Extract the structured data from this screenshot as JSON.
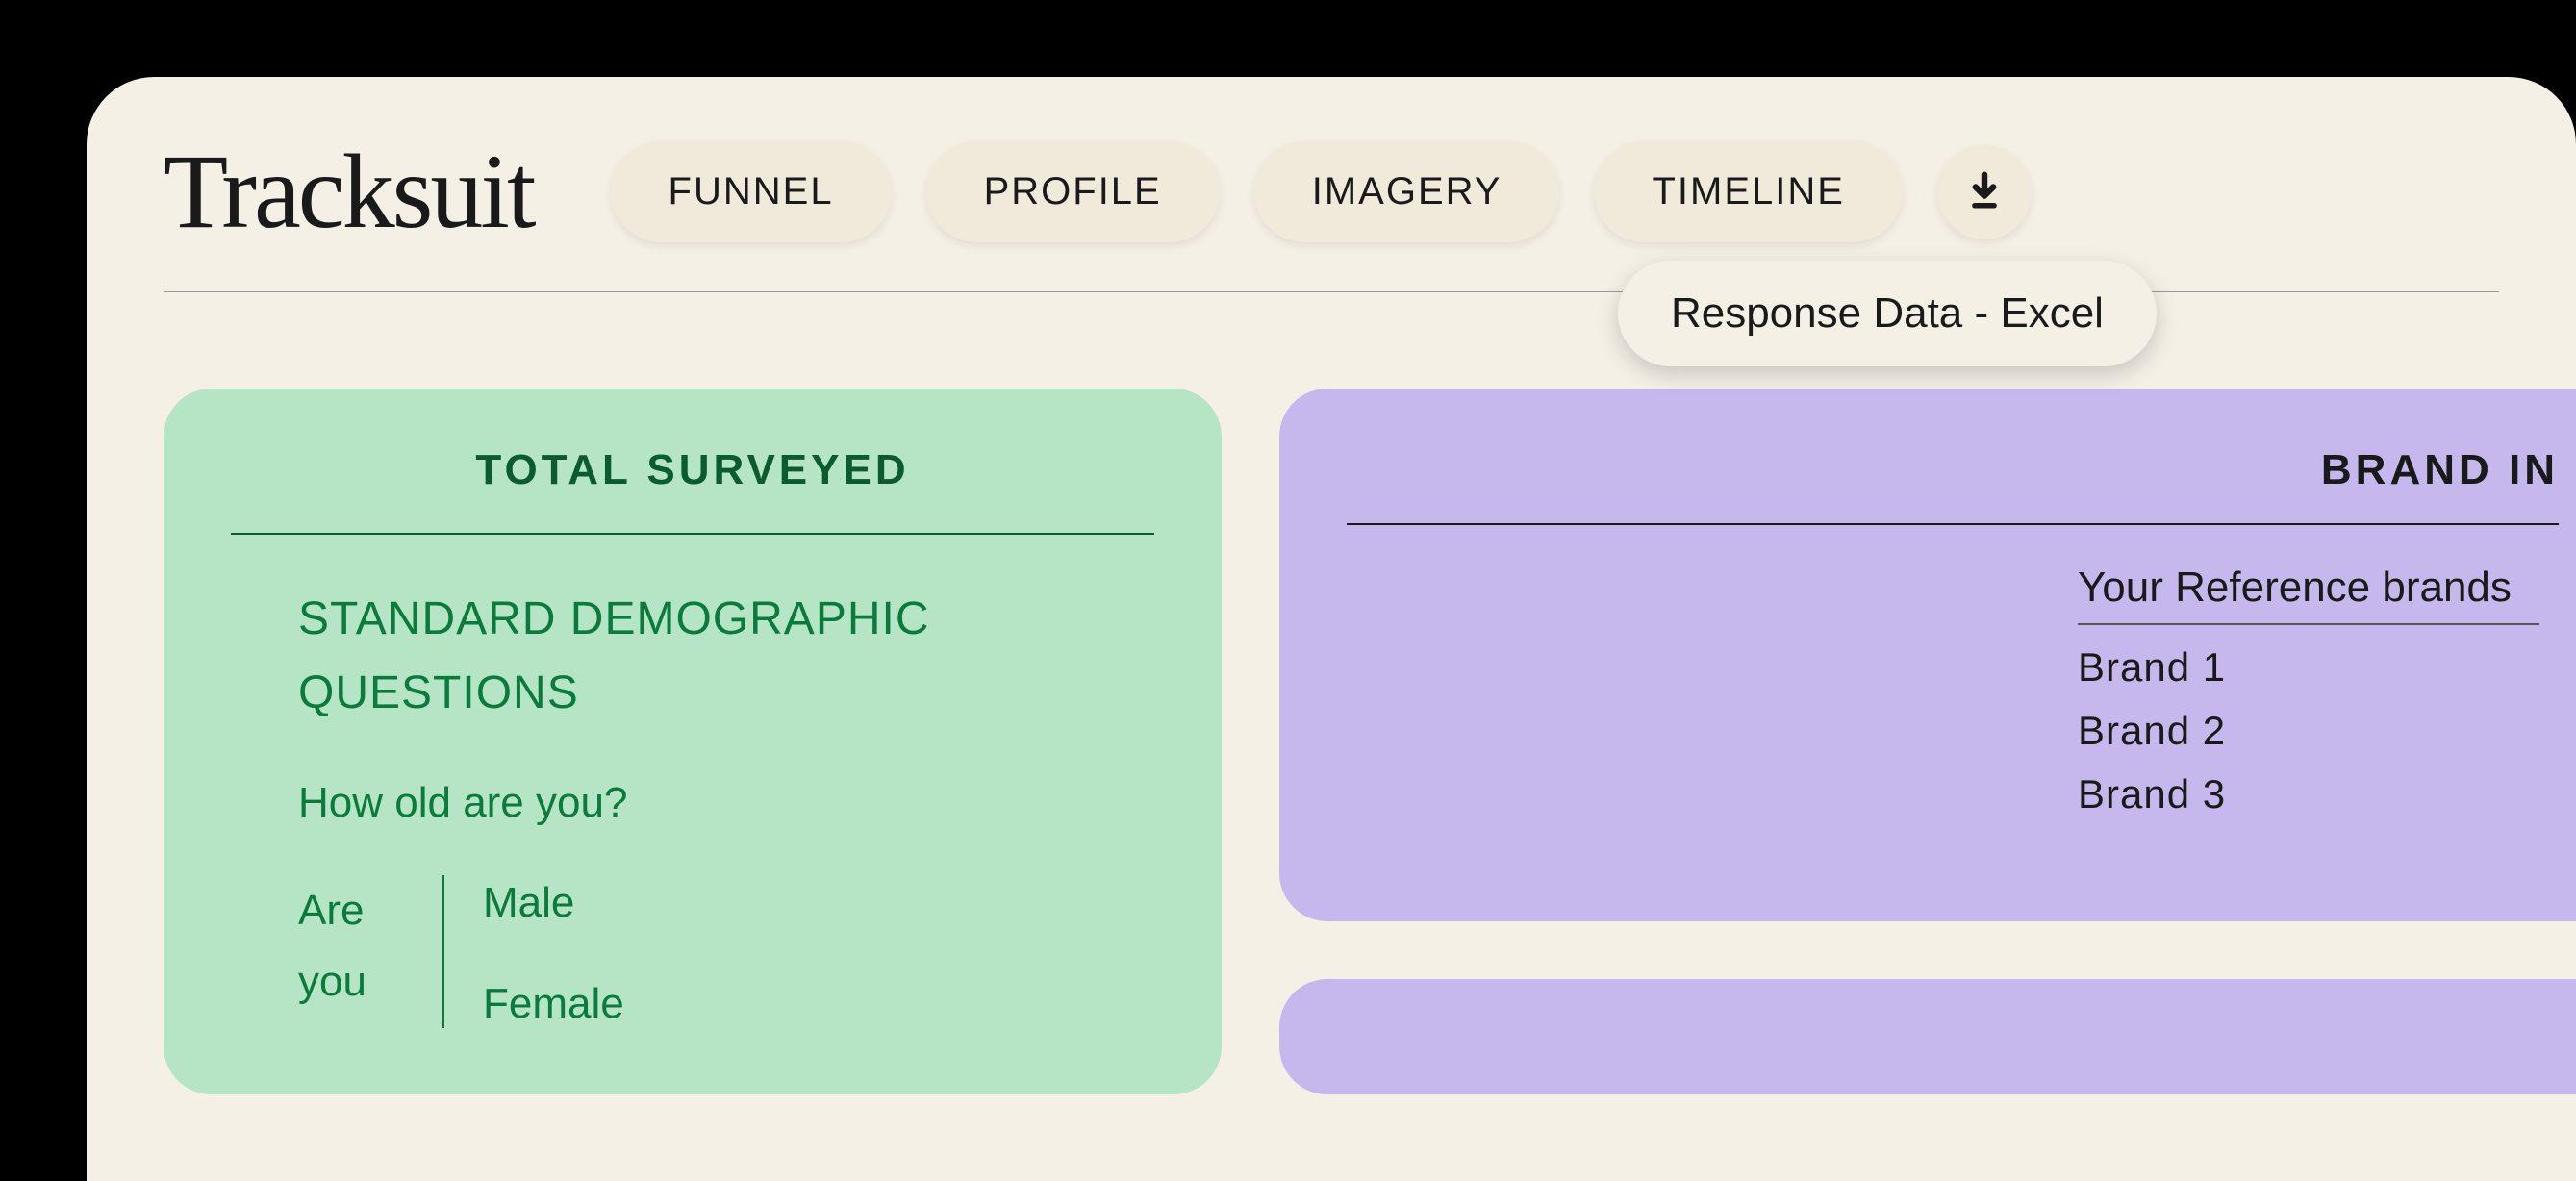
{
  "header": {
    "logo": "Tracksuit",
    "nav": {
      "items": [
        "FUNNEL",
        "PROFILE",
        "IMAGERY",
        "TIMELINE"
      ]
    },
    "download": {
      "icon_name": "download-icon",
      "dropdown_label": "Response Data - Excel"
    }
  },
  "cards": {
    "surveyed": {
      "title": "TOTAL SURVEYED",
      "subhead": "STANDARD DEMOGRAPHIC QUESTIONS",
      "question_age": "How old are you?",
      "question_gender_label": "Are you",
      "gender_options": [
        "Male",
        "Female"
      ]
    },
    "brand": {
      "title": "BRAND IN",
      "reference_label": "Your Reference brands",
      "brands": [
        "Brand 1",
        "Brand 2",
        "Brand 3"
      ]
    }
  }
}
